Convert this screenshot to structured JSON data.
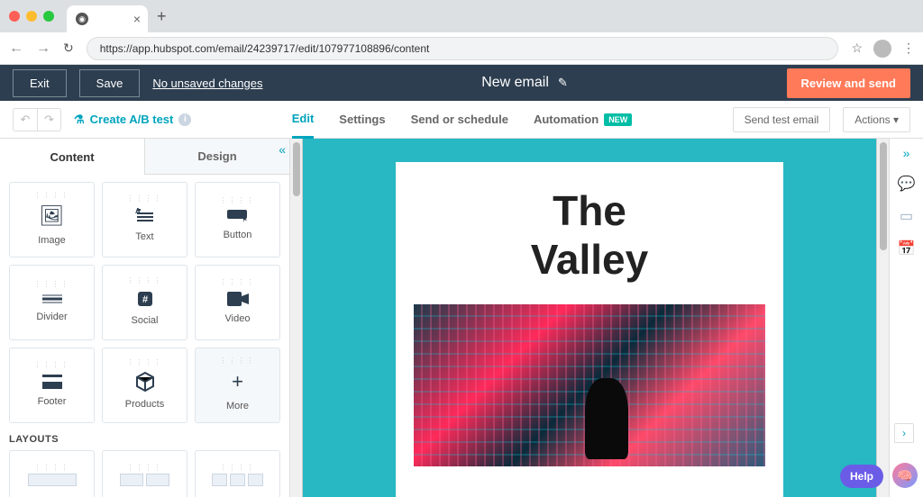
{
  "browser": {
    "url": "https://app.hubspot.com/email/24239717/edit/107977108896/content"
  },
  "header": {
    "exit": "Exit",
    "save": "Save",
    "unsaved": "No unsaved changes",
    "title": "New email",
    "review": "Review and send"
  },
  "subheader": {
    "ab_test": "Create A/B test",
    "tabs": {
      "edit": "Edit",
      "settings": "Settings",
      "send": "Send or schedule",
      "automation": "Automation"
    },
    "new_badge": "NEW",
    "send_test": "Send test email",
    "actions": "Actions"
  },
  "sidebar": {
    "tabs": {
      "content": "Content",
      "design": "Design"
    },
    "blocks": [
      {
        "label": "Image"
      },
      {
        "label": "Text"
      },
      {
        "label": "Button"
      },
      {
        "label": "Divider"
      },
      {
        "label": "Social"
      },
      {
        "label": "Video"
      },
      {
        "label": "Footer"
      },
      {
        "label": "Products"
      },
      {
        "label": "More"
      }
    ],
    "layouts_heading": "LAYOUTS"
  },
  "email": {
    "title_line1": "The",
    "title_line2": "Valley"
  },
  "help": "Help"
}
